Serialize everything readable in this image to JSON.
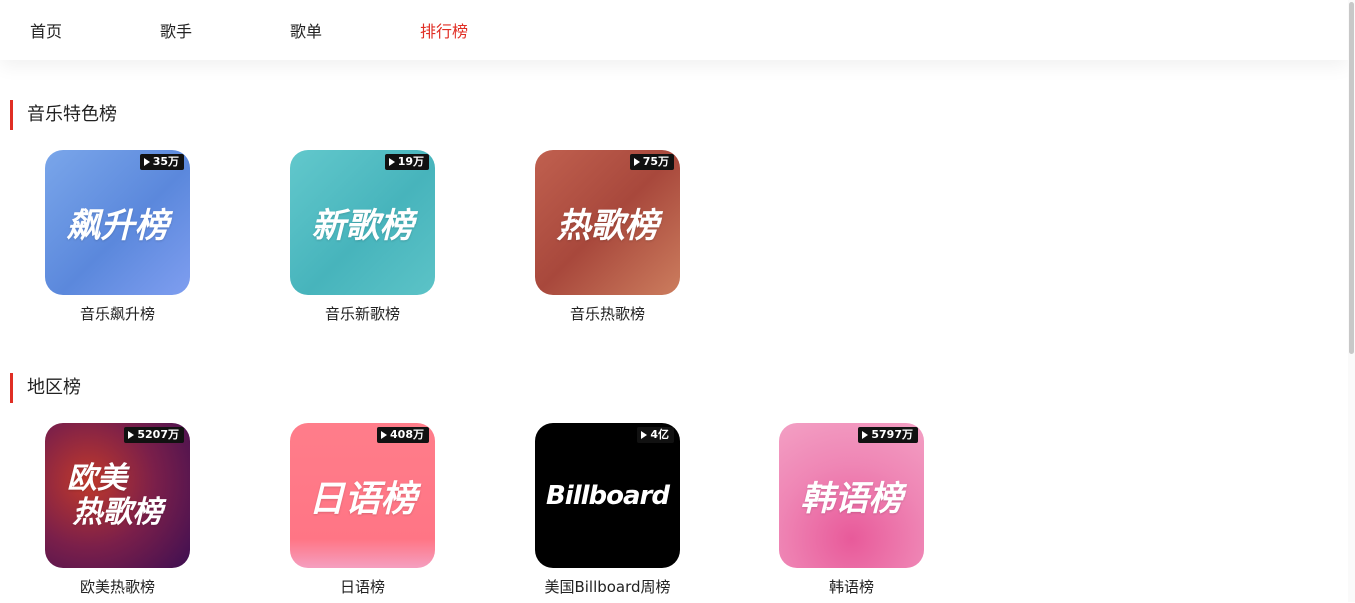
{
  "nav": {
    "tabs": [
      {
        "label": "首页"
      },
      {
        "label": "歌手"
      },
      {
        "label": "歌单"
      },
      {
        "label": "排行榜",
        "active": true
      }
    ],
    "active_color": "#e02e24"
  },
  "sections": [
    {
      "title": "音乐特色榜",
      "charts": [
        {
          "name": "音乐飙升榜",
          "play_count": "35万",
          "cover_text": "飙升榜",
          "colors": [
            "#6f9ee6",
            "#5a86dc"
          ]
        },
        {
          "name": "音乐新歌榜",
          "play_count": "19万",
          "cover_text": "新歌榜",
          "colors": [
            "#5ec6c8",
            "#44b3bb"
          ]
        },
        {
          "name": "音乐热歌榜",
          "play_count": "75万",
          "cover_text": "热歌榜",
          "colors": [
            "#c0604f",
            "#a8483c"
          ]
        }
      ]
    },
    {
      "title": "地区榜",
      "charts": [
        {
          "name": "欧美热歌榜",
          "play_count": "5207万",
          "cover_text_line1": "欧美",
          "cover_text_line2": "热歌榜",
          "colors": [
            "#4a1258",
            "#c0392b"
          ]
        },
        {
          "name": "日语榜",
          "play_count": "408万",
          "cover_text": "日语榜",
          "colors": [
            "#ff7b8a",
            "#ff6f80"
          ]
        },
        {
          "name": "美国Billboard周榜",
          "play_count": "4亿",
          "cover_text": "Billboard",
          "colors": [
            "#000000",
            "#000000"
          ]
        },
        {
          "name": "韩语榜",
          "play_count": "5797万",
          "cover_text": "韩语榜",
          "colors": [
            "#f08ab5",
            "#e46aa3"
          ]
        }
      ]
    }
  ]
}
